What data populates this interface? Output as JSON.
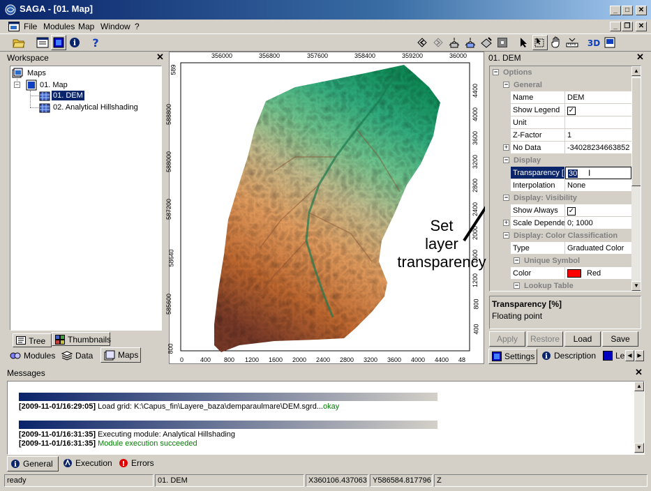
{
  "window": {
    "title": "SAGA - [01. Map]"
  },
  "menu": [
    "File",
    "Modules",
    "Map",
    "Window",
    "?"
  ],
  "workspace": {
    "title": "Workspace",
    "tree": {
      "root": "Maps",
      "map": "01. Map",
      "layers": [
        "01. DEM",
        "02. Analytical Hillshading"
      ]
    },
    "bottom_tabs": {
      "tree": "Tree",
      "thumbnails": "Thumbnails"
    },
    "tabs": [
      "Modules",
      "Data",
      "Maps"
    ]
  },
  "map": {
    "top_ticks": [
      "356000",
      "356800",
      "357600",
      "358400",
      "359200",
      "36000"
    ],
    "left_ticks": [
      "589",
      "588800",
      "588000",
      "587200",
      "58640",
      "585600",
      "800"
    ],
    "right_ticks": [
      "4400",
      "4000",
      "3600",
      "3200",
      "2800",
      "2400",
      "2000",
      "1600",
      "1200",
      "800",
      "400"
    ],
    "bottom_ticks": [
      "0",
      "400",
      "800",
      "1200",
      "1600",
      "2000",
      "2400",
      "2800",
      "3200",
      "3600",
      "4000",
      "4400",
      "48"
    ],
    "annotation": [
      "Set",
      "layer",
      "transparency"
    ]
  },
  "properties": {
    "title": "01. DEM",
    "rows": [
      {
        "type": "cat",
        "indent": 0,
        "name": "Options",
        "box": "minus"
      },
      {
        "type": "cat",
        "indent": 1,
        "name": "General",
        "box": "minus"
      },
      {
        "type": "prop",
        "name": "Name",
        "value": "DEM"
      },
      {
        "type": "prop",
        "name": "Show Legend",
        "check": true
      },
      {
        "type": "prop",
        "name": "Unit",
        "value": ""
      },
      {
        "type": "prop",
        "name": "Z-Factor",
        "value": "1"
      },
      {
        "type": "prop",
        "name": "No Data",
        "value": "-34028234663852",
        "box": "plus"
      },
      {
        "type": "cat",
        "indent": 1,
        "name": "Display",
        "box": "minus"
      },
      {
        "type": "prop",
        "name": "Transparency [",
        "value": "30",
        "selected": true
      },
      {
        "type": "prop",
        "name": "Interpolation",
        "value": "None"
      },
      {
        "type": "cat",
        "indent": 1,
        "name": "Display: Visibility",
        "box": "minus"
      },
      {
        "type": "prop",
        "name": "Show Always",
        "check": true
      },
      {
        "type": "prop",
        "name": "Scale Depender",
        "value": "0; 1000",
        "box": "plus"
      },
      {
        "type": "cat",
        "indent": 1,
        "name": "Display: Color Classification",
        "box": "minus"
      },
      {
        "type": "prop",
        "name": "Type",
        "value": "Graduated Color"
      },
      {
        "type": "cat",
        "indent": 2,
        "name": "Unique Symbol",
        "box": "minus"
      },
      {
        "type": "prop",
        "name": "Color",
        "value": "Red",
        "swatch": "#ff0000"
      },
      {
        "type": "cat",
        "indent": 2,
        "name": "Lookup Table",
        "box": "minus"
      }
    ],
    "description": {
      "title": "Transparency [%]",
      "text": "Floating point"
    },
    "buttons": {
      "apply": "Apply",
      "restore": "Restore",
      "load": "Load",
      "save": "Save"
    },
    "tabs": {
      "settings": "Settings",
      "description": "Description",
      "legend": "Le"
    }
  },
  "messages": {
    "title": "Messages",
    "lines": [
      {
        "time": "[2009-11-01/16:29:05]",
        "text": "Load grid: K:\\Capus_fin\\Layere_baza\\demparaulmare\\DEM.sgrd...",
        "status": "okay"
      },
      {
        "time": "[2009-11-01/16:31:35]",
        "text": "Executing module: Analytical Hillshading",
        "status": ""
      },
      {
        "time": "[2009-11-01/16:31:35]",
        "text": "Module execution succeeded",
        "status": ""
      }
    ],
    "tabs": [
      "General",
      "Execution",
      "Errors"
    ]
  },
  "status": {
    "ready": "ready",
    "layer": "01. DEM",
    "x": "X360106.437063",
    "y": "Y586584.817796",
    "z": "Z"
  },
  "colors": {
    "title_bar": "#0a246a",
    "selection": "#0a246a",
    "ok_green": "#008000"
  }
}
